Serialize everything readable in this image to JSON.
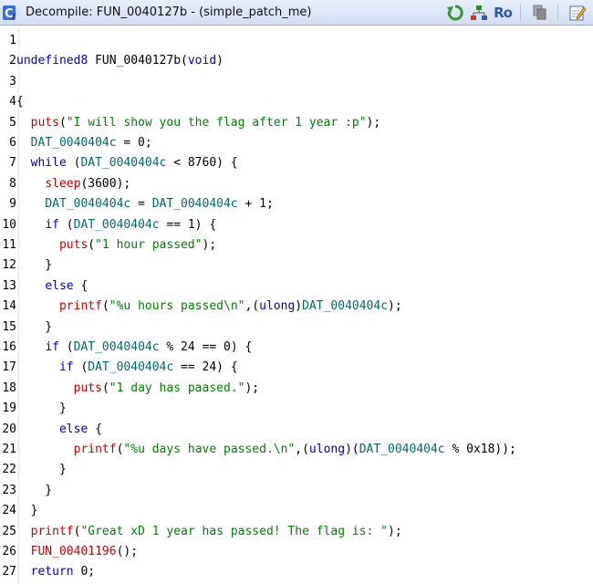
{
  "window": {
    "title": "Decompile: FUN_0040127b -  (simple_patch_me)",
    "icon": "decompile-icon",
    "toolbar": [
      {
        "name": "refresh-icon"
      },
      {
        "name": "graph-icon"
      },
      {
        "name": "read-only-toggle",
        "label": "Ro"
      },
      {
        "name": "copy-icon"
      },
      {
        "name": "edit-icon"
      }
    ]
  },
  "code": {
    "lines": [
      {
        "n": "1",
        "text": ""
      },
      {
        "n": "2",
        "text": "undefined8 FUN_0040127b(void)"
      },
      {
        "n": "3",
        "text": ""
      },
      {
        "n": "4",
        "text": "{"
      },
      {
        "n": "5",
        "text": "  puts(\"I will show you the flag after 1 year :p\");"
      },
      {
        "n": "6",
        "text": "  DAT_0040404c = 0;"
      },
      {
        "n": "7",
        "text": "  while (DAT_0040404c < 8760) {"
      },
      {
        "n": "8",
        "text": "    sleep(3600);"
      },
      {
        "n": "9",
        "text": "    DAT_0040404c = DAT_0040404c + 1;"
      },
      {
        "n": "10",
        "text": "    if (DAT_0040404c == 1) {"
      },
      {
        "n": "11",
        "text": "      puts(\"1 hour passed\");"
      },
      {
        "n": "12",
        "text": "    }"
      },
      {
        "n": "13",
        "text": "    else {"
      },
      {
        "n": "14",
        "text": "      printf(\"%u hours passed\\n\",(ulong)DAT_0040404c);"
      },
      {
        "n": "15",
        "text": "    }"
      },
      {
        "n": "16",
        "text": "    if (DAT_0040404c % 24 == 0) {"
      },
      {
        "n": "17",
        "text": "      if (DAT_0040404c == 24) {"
      },
      {
        "n": "18",
        "text": "        puts(\"1 day has paased.\");"
      },
      {
        "n": "19",
        "text": "      }"
      },
      {
        "n": "20",
        "text": "      else {"
      },
      {
        "n": "21",
        "text": "        printf(\"%u days have passed.\\n\",(ulong)(DAT_0040404c % 0x18));"
      },
      {
        "n": "22",
        "text": "      }"
      },
      {
        "n": "23",
        "text": "    }"
      },
      {
        "n": "24",
        "text": "  }"
      },
      {
        "n": "25",
        "text": "  printf(\"Great xD 1 year has passed! The flag is: \");"
      },
      {
        "n": "26",
        "text": "  FUN_00401196();"
      },
      {
        "n": "27",
        "text": "  return 0;"
      }
    ]
  },
  "colors": {
    "keyword": "#0000c8",
    "function": "#c80000",
    "string": "#008000",
    "variable": "#006a6a"
  }
}
